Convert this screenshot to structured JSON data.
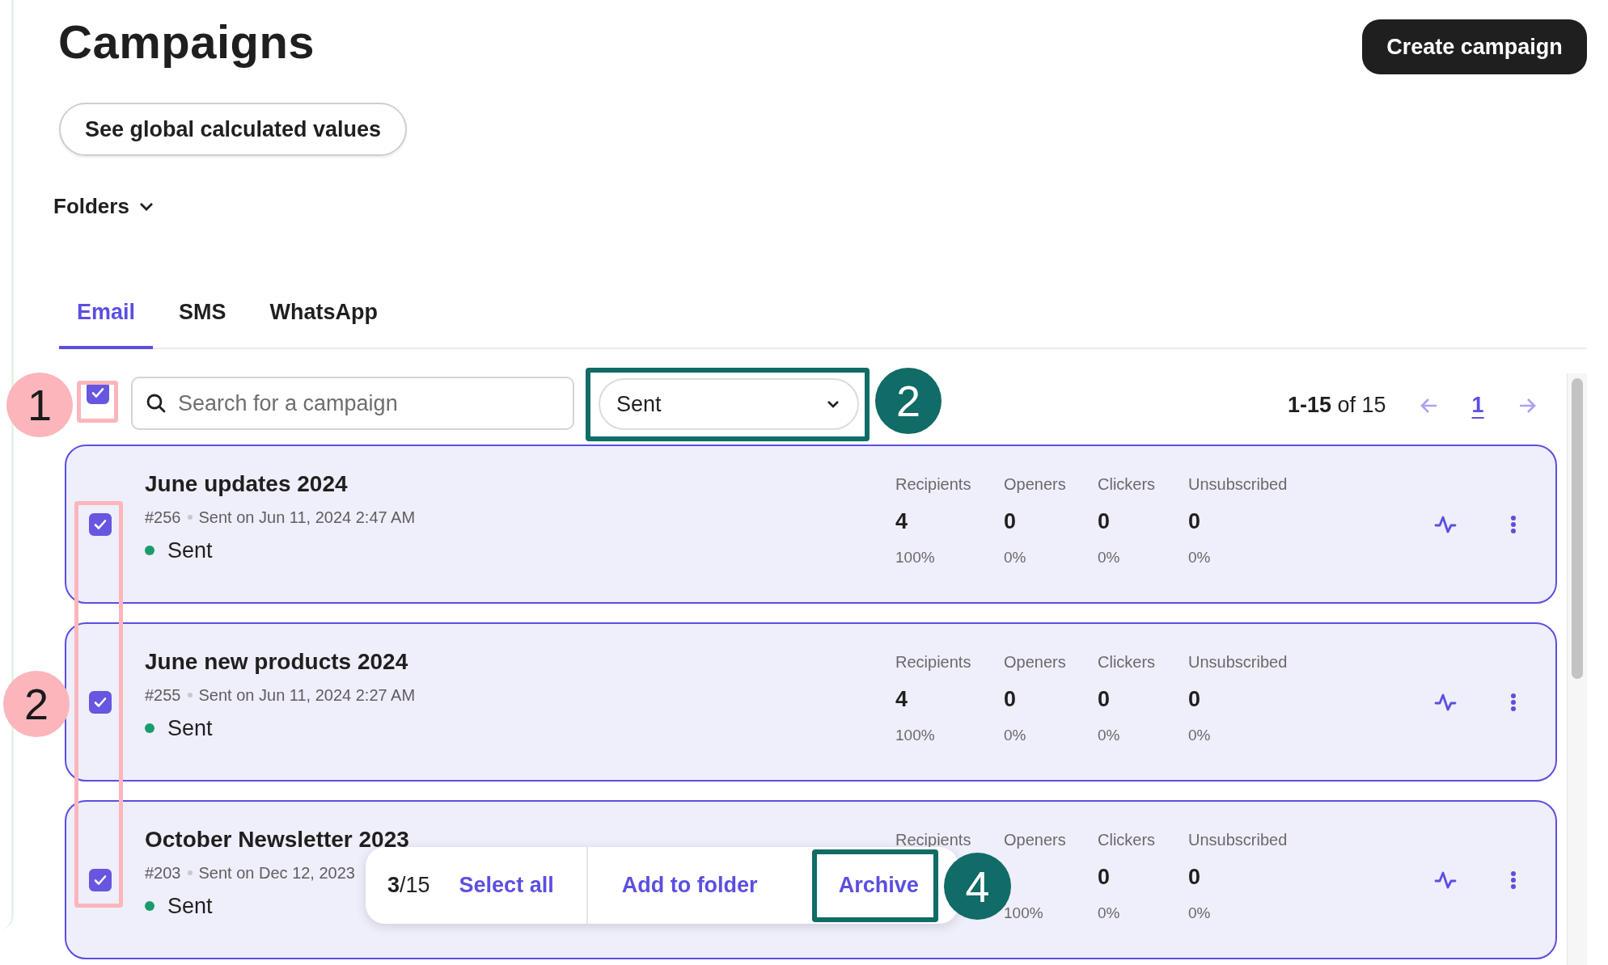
{
  "header": {
    "title": "Campaigns",
    "create_button": "Create campaign",
    "global_values_button": "See global calculated values",
    "folders": "Folders"
  },
  "tabs": [
    {
      "label": "Email",
      "selected": true
    },
    {
      "label": "SMS",
      "selected": false
    },
    {
      "label": "WhatsApp",
      "selected": false
    }
  ],
  "toolbar": {
    "select_all_checked": true,
    "search": {
      "placeholder": "Search for a campaign"
    },
    "status_filter": "Sent",
    "pagination": {
      "range": "**1-15** of 15",
      "page": "1"
    }
  },
  "campaigns": [
    {
      "name": "June updates 2024",
      "number": "#256",
      "sent_on": "Sent on Jun 11, 2024 2:47 AM",
      "status": "Sent",
      "color": "#1a9b6c",
      "checked": true,
      "stats": [
        {
          "label": "Recipients",
          "value": "4",
          "percent": "100%"
        },
        {
          "label": "Openers",
          "value": "0",
          "percent": "0%"
        },
        {
          "label": "Clickers",
          "value": "0",
          "percent": "0%"
        },
        {
          "label": "Unsubscribed",
          "value": "0",
          "percent": "0%"
        }
      ]
    },
    {
      "name": "June new products 2024",
      "number": "#255",
      "sent_on": "Sent on Jun 11, 2024 2:27 AM",
      "status": "Sent",
      "color": "#1a9b6c",
      "checked": true,
      "stats": [
        {
          "label": "Recipients",
          "value": "4",
          "percent": "100%"
        },
        {
          "label": "Openers",
          "value": "0",
          "percent": "0%"
        },
        {
          "label": "Clickers",
          "value": "0",
          "percent": "0%"
        },
        {
          "label": "Unsubscribed",
          "value": "0",
          "percent": "0%"
        }
      ]
    },
    {
      "name": "October Newsletter 2023",
      "number": "#203",
      "sent_on": "Sent on Dec 12, 2023",
      "status": "Sent",
      "color": "#1a9b6c",
      "checked": true,
      "stats": [
        {
          "label": "Recipients"
        },
        {
          "label": "Openers",
          "percent": "100%"
        },
        {
          "label": "Clickers",
          "value": "0",
          "percent": "0%"
        },
        {
          "label": "Unsubscribed",
          "value": "0",
          "percent": "0%"
        }
      ]
    }
  ],
  "bulk_bar": {
    "count": "**3**/15",
    "actions": [
      "Select all",
      "Add to folder",
      "Archive"
    ]
  },
  "annotations": [
    {
      "kind": "circle",
      "label": "1",
      "color": "#fbb5bb"
    },
    {
      "kind": "box",
      "color": "#fbb5bb"
    },
    {
      "kind": "box",
      "color": "#fbb5bb"
    },
    {
      "kind": "circle",
      "label": "2",
      "color": "#fbb5bb"
    },
    {
      "kind": "box",
      "color": "#116b66"
    },
    {
      "kind": "circle",
      "label": "2",
      "color": "#116b66"
    },
    {
      "kind": "box",
      "color": "#116b66"
    },
    {
      "kind": "circle",
      "label": "4",
      "color": "#116b66"
    }
  ]
}
